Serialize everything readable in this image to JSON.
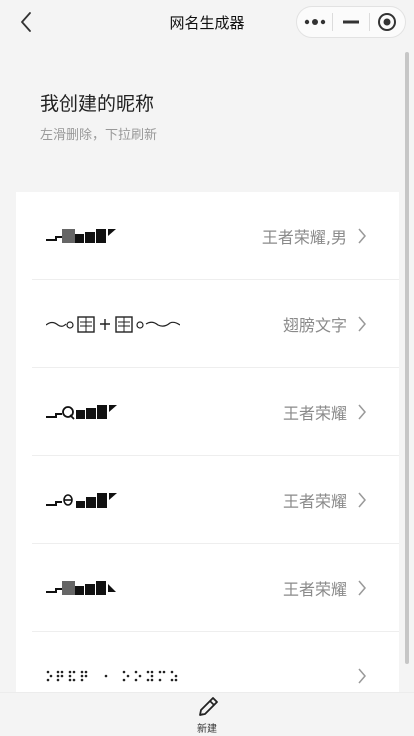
{
  "navbar": {
    "title": "网名生成器",
    "back_icon": "chevron-left-icon",
    "capsule": {
      "more_icon": "more-dots-icon",
      "minimize_icon": "minimize-icon",
      "close_icon": "target-circle-icon"
    }
  },
  "header": {
    "title": "我创建的昵称",
    "hint": "左滑删除，下拉刷新"
  },
  "list": {
    "items": [
      {
        "nickname": "╼▒▆▇◤",
        "tag": "王者荣耀,男"
      },
      {
        "nickname": "~☙ꕥ饕·☩·餮ꕥ☙~",
        "tag": "翅膀文字"
      },
      {
        "nickname": "╼Q▆▇◤",
        "tag": "王者荣耀"
      },
      {
        "nickname": "╼Θ▄▆◤",
        "tag": "王者荣耀"
      },
      {
        "nickname": "╼▒▆▇◣",
        "tag": "王者荣耀"
      },
      {
        "nickname": "⠨⠏⠗ ⠂⠅⠊⠟⠍",
        "tag": ""
      }
    ]
  },
  "bottom_bar": {
    "new_label": "新建",
    "new_icon": "pencil-icon"
  }
}
